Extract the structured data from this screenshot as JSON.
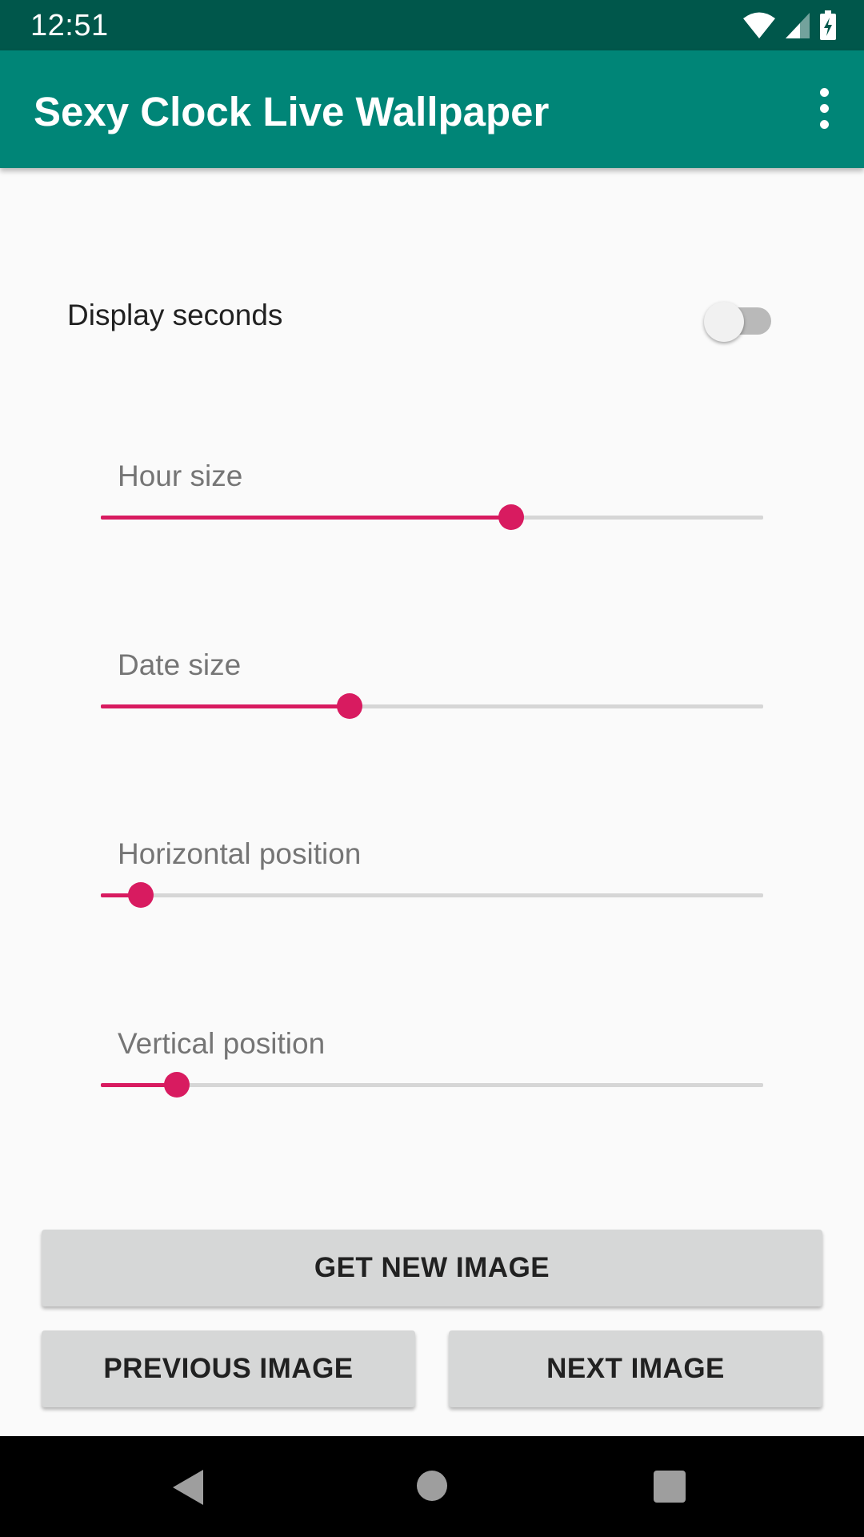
{
  "status_bar": {
    "time": "12:51",
    "icons": [
      "wifi-icon",
      "cellular-signal-icon",
      "battery-charging-icon"
    ],
    "background_color": "#00574b"
  },
  "app_bar": {
    "title": "Sexy Clock Live Wallpaper",
    "menu_icon": "more-vert-icon",
    "background_color": "#008577"
  },
  "settings": {
    "display_seconds": {
      "label": "Display seconds",
      "checked": false
    },
    "sliders": [
      {
        "label": "Hour size",
        "value": 0.62
      },
      {
        "label": "Date size",
        "value": 0.375
      },
      {
        "label": "Horizontal position",
        "value": 0.06
      },
      {
        "label": "Vertical position",
        "value": 0.115
      }
    ],
    "accent_color": "#d81b60"
  },
  "buttons": {
    "get_new_image": "GET NEW IMAGE",
    "previous_image": "PREVIOUS IMAGE",
    "next_image": "NEXT IMAGE"
  },
  "nav_bar": {
    "icons": [
      "back-icon",
      "home-icon",
      "recents-icon"
    ]
  }
}
